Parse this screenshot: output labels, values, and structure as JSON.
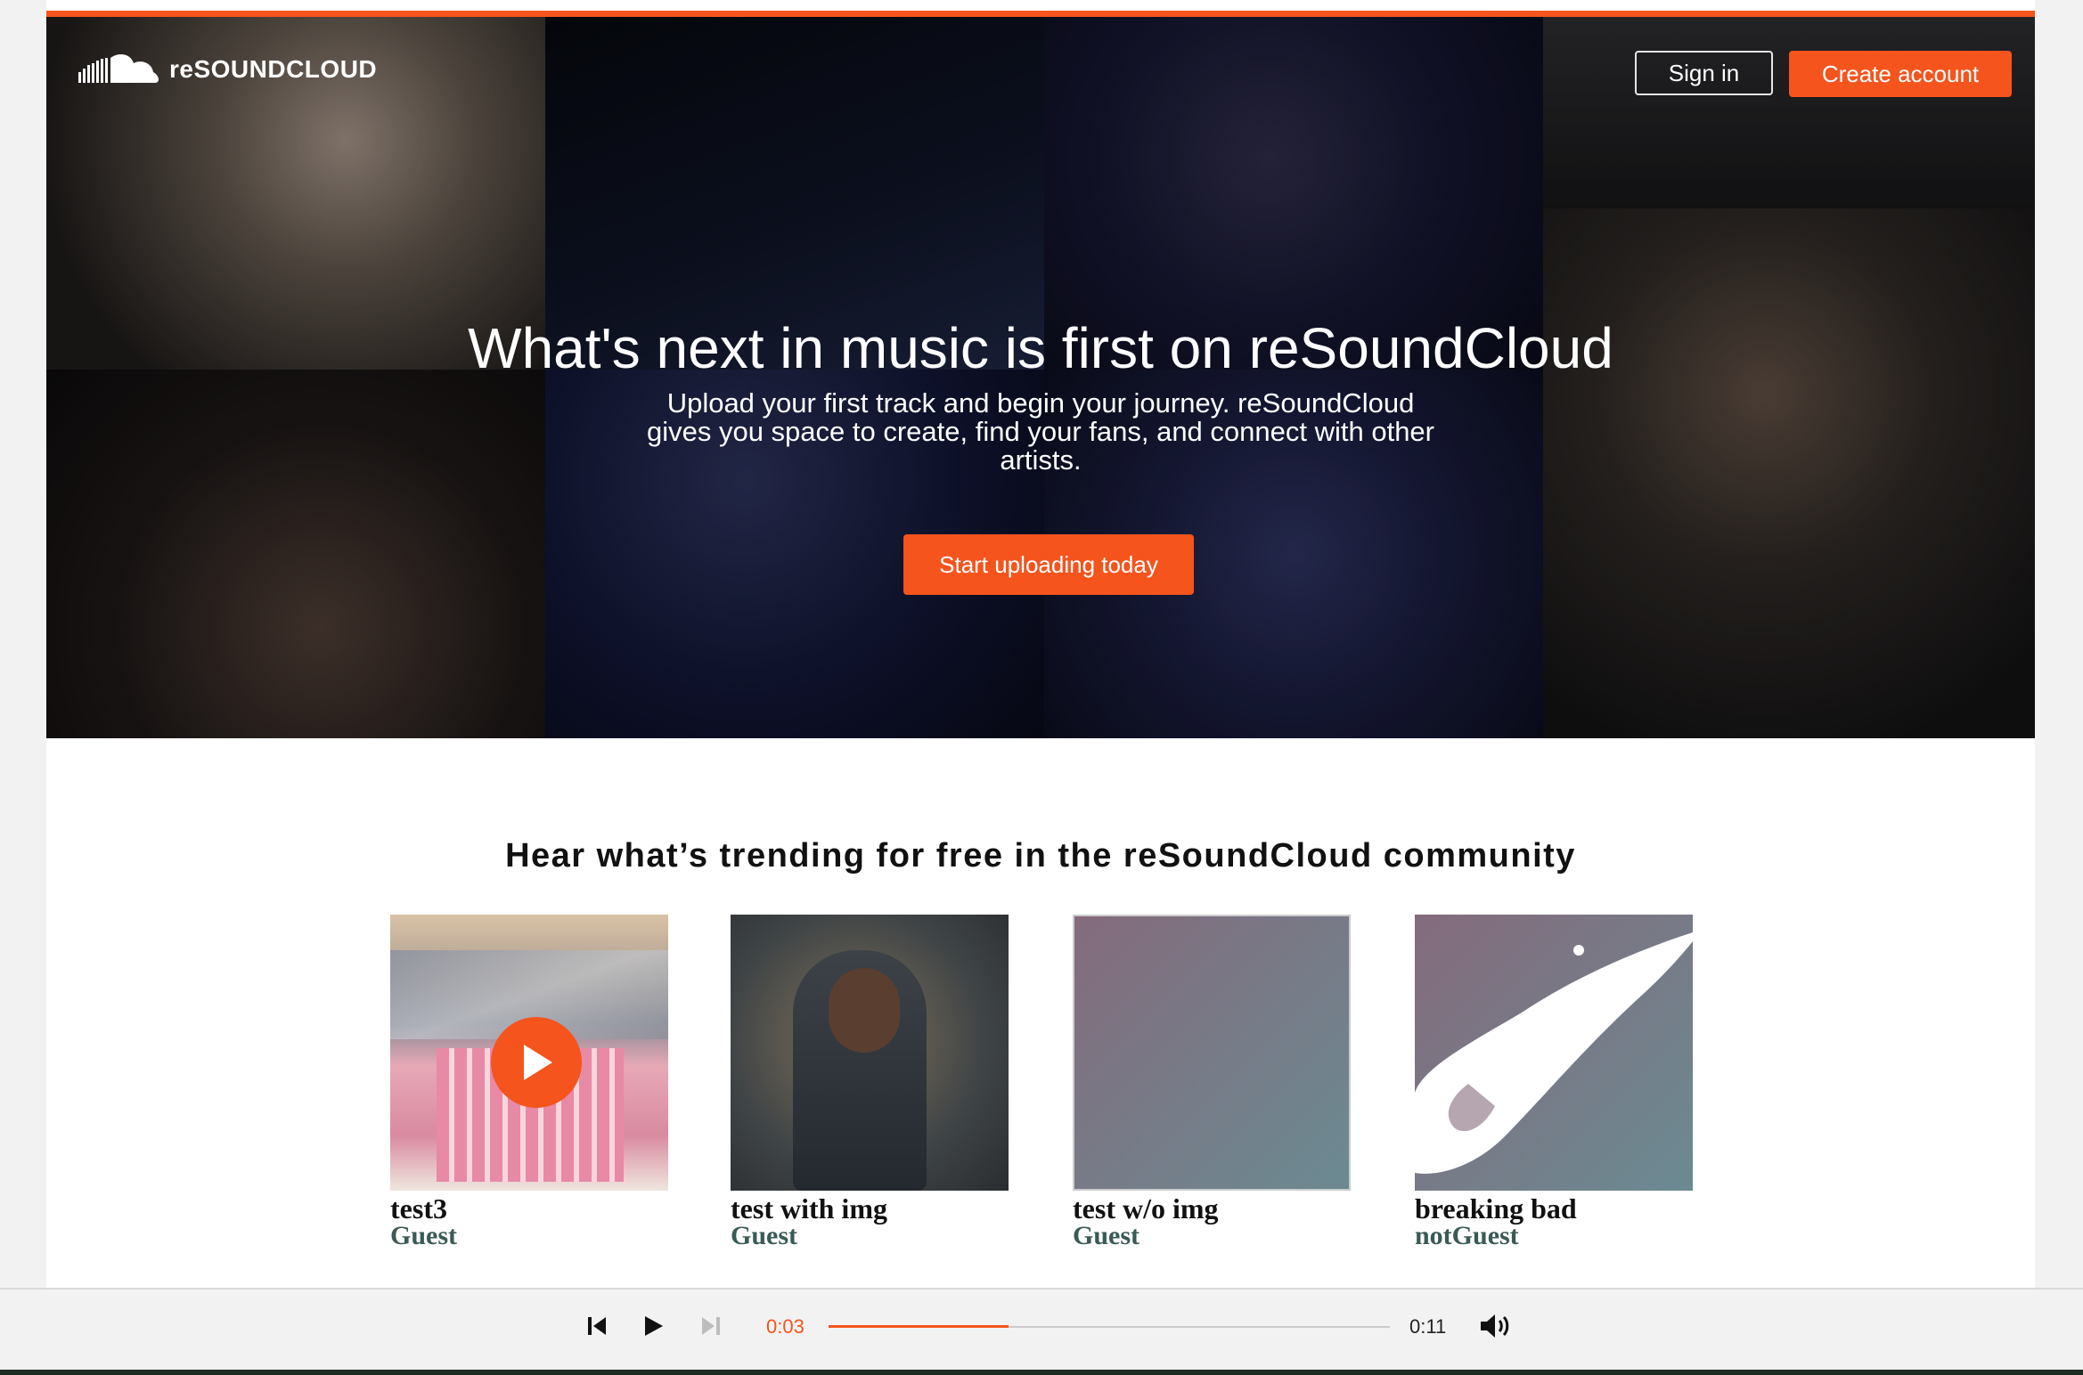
{
  "brand": {
    "name": "reSOUNDCLOUD"
  },
  "header": {
    "sign_in": "Sign in",
    "create_account": "Create account"
  },
  "hero": {
    "title": "What's next in music is first on reSoundCloud",
    "subtitle": "Upload your first track and begin your journey. reSoundCloud gives you space to create, find your fans, and connect with other artists.",
    "cta": "Start uploading today"
  },
  "trending": {
    "title": "Hear what’s trending for free in the reSoundCloud community",
    "tracks": [
      {
        "title": "test3",
        "artist": "Guest"
      },
      {
        "title": "test with img",
        "artist": "Guest"
      },
      {
        "title": "test w/o img",
        "artist": "Guest"
      },
      {
        "title": "breaking bad",
        "artist": "notGuest"
      }
    ]
  },
  "player": {
    "current_time": "0:03",
    "total_time": "0:11",
    "progress_fraction": 0.32,
    "icons": [
      "skip-back-icon",
      "play-icon",
      "skip-forward-icon",
      "volume-icon"
    ]
  },
  "colors": {
    "accent": "#f5541d",
    "artist_text": "#3a5a55"
  }
}
